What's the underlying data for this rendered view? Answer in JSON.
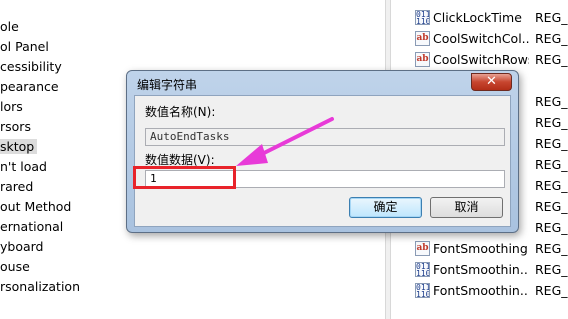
{
  "tree": {
    "items": [
      "ole",
      "ol Panel",
      "cessibility",
      "pearance",
      "lors",
      "rsors",
      "sktop",
      "n't load",
      "rared",
      "out Method",
      "ernational",
      "yboard",
      "ouse",
      "rsonalization"
    ],
    "selected_index": 6
  },
  "values": {
    "rows": [
      {
        "name": "ClickLockTime",
        "type": "REG_",
        "icon": "binary-value-icon"
      },
      {
        "name": "CoolSwitchCol...",
        "type": "REG_",
        "icon": "string-value-icon"
      },
      {
        "name": "CoolSwitchRows",
        "type": "REG_",
        "icon": "string-value-icon"
      },
      {
        "name": "FontSmoothing",
        "type": "REG_",
        "icon": "string-value-icon"
      },
      {
        "name": "FontSmoothin...",
        "type": "REG_",
        "icon": "binary-value-icon"
      },
      {
        "name": "FontSmoothin...",
        "type": "REG_",
        "icon": "binary-value-icon"
      }
    ],
    "partial_type_labels": [
      "REG_",
      "REG_",
      "REG_",
      "REG_",
      "REG_",
      "REG_",
      "REG_"
    ]
  },
  "dialog": {
    "title": "编辑字符串",
    "close_symbol": "✕",
    "value_name_label": "数值名称(N):",
    "value_name": "AutoEndTasks",
    "value_data_label": "数值数据(V):",
    "value_data": "1",
    "ok_label": "确定",
    "cancel_label": "取消"
  },
  "annotations": {
    "highlight_color": "#e8232a",
    "arrow_color": "#e83ad8"
  }
}
